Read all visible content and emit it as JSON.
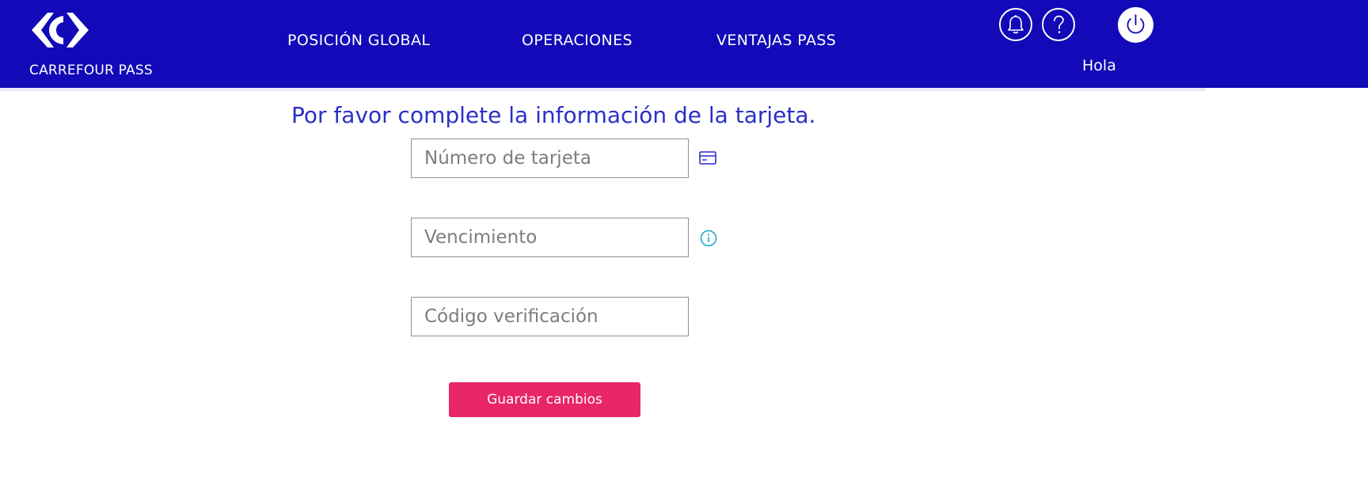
{
  "header": {
    "brand": "CARREFOUR PASS",
    "nav": [
      {
        "label": "POSICIÓN GLOBAL"
      },
      {
        "label": "OPERACIONES"
      },
      {
        "label": "VENTAJAS PASS"
      }
    ],
    "greeting": "Hola",
    "icons": {
      "logo": "carrefour-logo",
      "notifications": "bell-icon",
      "help": "question-icon",
      "logout": "power-icon"
    }
  },
  "form": {
    "title": "Por favor complete la información de la tarjeta.",
    "card_number": {
      "placeholder": "Número de tarjeta",
      "value": ""
    },
    "expiry": {
      "placeholder": "Vencimiento",
      "value": ""
    },
    "verification_code": {
      "placeholder": "Código verificación",
      "value": ""
    },
    "card_icon": "credit-card-icon",
    "info_icon": "info-icon",
    "submit_label": "Guardar cambios"
  },
  "colors": {
    "header_bg": "#1209b8",
    "title": "#2a2fc7",
    "button_bg": "#e82565",
    "icon_blue": "#2a2fc7",
    "info_cyan": "#1aa6c8"
  }
}
